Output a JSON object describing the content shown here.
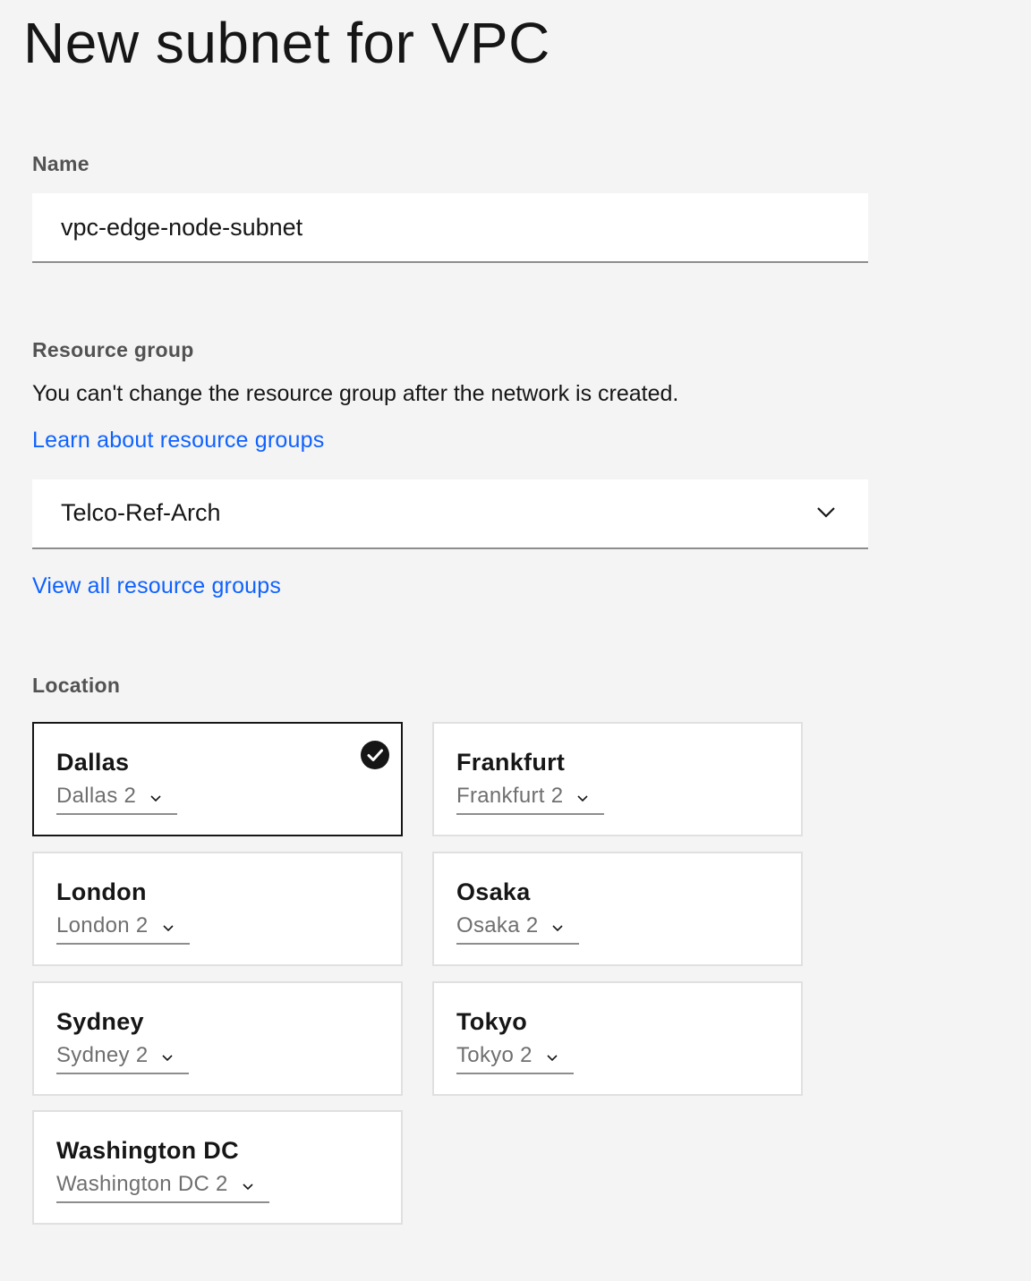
{
  "page": {
    "title": "New subnet for VPC"
  },
  "name_field": {
    "label": "Name",
    "value": "vpc-edge-node-subnet"
  },
  "resource_group": {
    "label": "Resource group",
    "helper": "You can't change the resource group after the network is created.",
    "learn_link": "Learn about resource groups",
    "selected": "Telco-Ref-Arch",
    "view_all_link": "View all resource groups"
  },
  "location": {
    "label": "Location",
    "tiles": [
      {
        "name": "Dallas",
        "zone": "Dallas 2",
        "selected": true
      },
      {
        "name": "Frankfurt",
        "zone": "Frankfurt 2",
        "selected": false
      },
      {
        "name": "London",
        "zone": "London 2",
        "selected": false
      },
      {
        "name": "Osaka",
        "zone": "Osaka 2",
        "selected": false
      },
      {
        "name": "Sydney",
        "zone": "Sydney 2",
        "selected": false
      },
      {
        "name": "Tokyo",
        "zone": "Tokyo 2",
        "selected": false
      },
      {
        "name": "Washington DC",
        "zone": "Washington DC 2",
        "selected": false
      }
    ]
  },
  "icons": {
    "select_chevron": "chevron-down-icon",
    "zone_chevron": "chevron-down-icon",
    "selected_check": "checkmark-filled-icon"
  },
  "colors": {
    "background": "#f4f4f4",
    "link": "#0f62fe",
    "selected_border": "#161616"
  }
}
